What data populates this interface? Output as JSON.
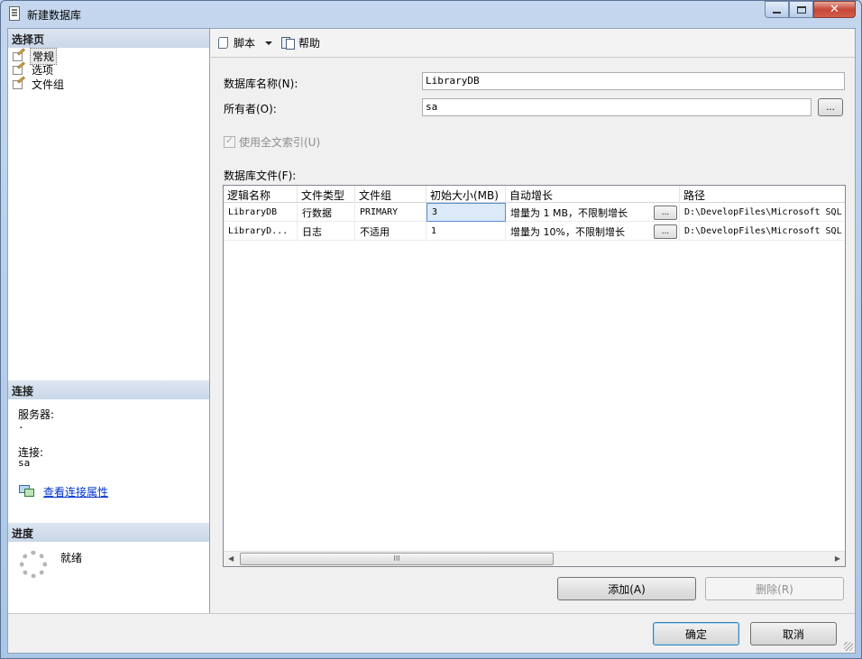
{
  "window": {
    "title": "新建数据库",
    "buttons": [
      "minimize",
      "maximize",
      "close"
    ]
  },
  "left": {
    "select_page_header": "选择页",
    "pages": [
      {
        "label": "常规",
        "icon": "page-edit-icon",
        "selected": true
      },
      {
        "label": "选项",
        "icon": "page-edit-icon",
        "selected": false
      },
      {
        "label": "文件组",
        "icon": "page-edit-icon",
        "selected": false
      }
    ],
    "connection_header": "连接",
    "server_label": "服务器:",
    "server_value": ".",
    "connection_label": "连接:",
    "connection_value": "sa",
    "view_connection_link": "查看连接属性",
    "progress_header": "进度",
    "progress_status": "就绪"
  },
  "toolbar": {
    "script_label": "脚本",
    "help_label": "帮助"
  },
  "form": {
    "db_name_label": "数据库名称(N):",
    "db_name_value": "LibraryDB",
    "owner_label": "所有者(O):",
    "owner_value": "sa",
    "owner_browse": "...",
    "fulltext_label": "使用全文索引(U)",
    "fulltext_checked": true,
    "db_files_label": "数据库文件(F):"
  },
  "grid": {
    "columns": [
      "逻辑名称",
      "文件类型",
      "文件组",
      "初始大小(MB)",
      "自动增长",
      "路径"
    ],
    "rows": [
      {
        "name": "LibraryDB",
        "type": "行数据",
        "filegroup": "PRIMARY",
        "size": "3",
        "growth": "增量为 1 MB，不限制增长",
        "growth_btn": "...",
        "path": "D:\\DevelopFiles\\Microsoft SQL"
      },
      {
        "name": "LibraryD...",
        "type": "日志",
        "filegroup": "不适用",
        "size": "1",
        "growth": "增量为 10%，不限制增长",
        "growth_btn": "...",
        "path": "D:\\DevelopFiles\\Microsoft SQL"
      }
    ],
    "scroll_thumb_label": "III"
  },
  "actions": {
    "add_label": "添加(A)",
    "remove_label": "删除(R)",
    "ok_label": "确定",
    "cancel_label": "取消"
  }
}
